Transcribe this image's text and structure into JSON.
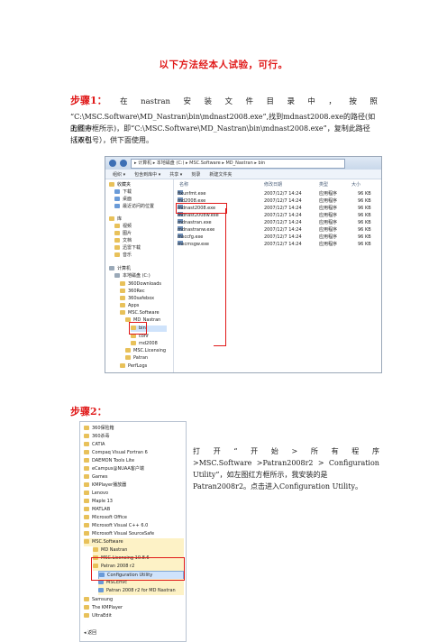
{
  "title": "以下方法经本人试验，可行。",
  "step1": {
    "label": "步骤1：",
    "line1_words": [
      "在",
      "nastran",
      "安",
      "装",
      "文",
      "件",
      "目",
      "录",
      "中",
      "，",
      "按",
      "照"
    ],
    "line2": "“C:\\MSC.Software\\MD_Nastran\\bin\\mdnast2008.exe”,找到mdnast2008.exe的路径(如上图中",
    "line3": "的红方框所示)，即“C:\\MSC.Software\\MD_Nastran\\bin\\mdnast2008.exe”，复制此路径（不包",
    "line4": "括双引号），供下面使用。"
  },
  "explorer": {
    "path": "▸ 计算机 ▸ 本地磁盘 (C:) ▸ MSC.Software ▸ MD_Nastran ▸ bin",
    "toolbar": [
      "组织 ▾",
      "包含到库中 ▾",
      "共享 ▾",
      "刻录",
      "新建文件夹"
    ],
    "nav_items": [
      "收藏夹",
      "下载",
      "桌面",
      "最近访问的位置",
      "库",
      "视频",
      "图片",
      "文档",
      "迅雷下载",
      "音乐",
      "计算机",
      "本地磁盘 (C:)",
      "360Downloads",
      "360Rec",
      "360safebox",
      "Apps",
      "MSC.Software",
      "MD_Nastran",
      "bin",
      "conf",
      "md2008",
      "MSC.Licensing",
      "Patran",
      "PerfLogs"
    ],
    "columns": [
      "名称",
      "修改日期",
      "类型",
      "大小"
    ],
    "files": [
      {
        "name": "fixunfmt.exe",
        "date": "2007/12/7 14:24",
        "type": "应用程序",
        "size": "96 KB"
      },
      {
        "name": "md2008.exe",
        "date": "2007/12/7 14:24",
        "type": "应用程序",
        "size": "96 KB"
      },
      {
        "name": "mdnast2008.exe",
        "date": "2007/12/7 14:24",
        "type": "应用程序",
        "size": "96 KB"
      },
      {
        "name": "mdnast2008w.exe",
        "date": "2007/12/7 14:24",
        "type": "应用程序",
        "size": "96 KB"
      },
      {
        "name": "mdnastran.exe",
        "date": "2007/12/7 14:24",
        "type": "应用程序",
        "size": "96 KB"
      },
      {
        "name": "mdnastranw.exe",
        "date": "2007/12/7 14:24",
        "type": "应用程序",
        "size": "96 KB"
      },
      {
        "name": "msccfg.exe",
        "date": "2007/12/7 14:24",
        "type": "应用程序",
        "size": "96 KB"
      },
      {
        "name": "mscmsgw.exe",
        "date": "2007/12/7 14:24",
        "type": "应用程序",
        "size": "96 KB"
      }
    ]
  },
  "step2": {
    "label": "步骤2：",
    "line1_words": [
      "打",
      "开",
      "“",
      "开",
      "始",
      ">",
      "所",
      "有",
      "程",
      "序"
    ],
    "line2_left": ">MSC.Software",
    "line2_mid": ">Patran2008r2",
    "line2_sep": ">",
    "line2_right": "Configuration",
    "line3": "Utility”，如左图红方框所示，我安装的是",
    "line4": "Patran2008r2。点击进入Configuration Utility。"
  },
  "start_menu": {
    "items": [
      "360保险箱",
      "360杀毒",
      "CATIA",
      "Compaq Visual Fortran 6",
      "DAEMON Tools Lite",
      "eCampus@NUAA客户端",
      "Games",
      "KMPlayer播放器",
      "Lenovo",
      "Maple 13",
      "MATLAB",
      "Microsoft Office",
      "Microsoft Visual C++ 6.0",
      "Microsoft Visual SourceSafe",
      "MSC.Software",
      "MD Nastran",
      "MSC.Licensing 10.8.6",
      "Patran 2008 r2",
      "Configuration Utility",
      "MSCEnvc",
      "Patran 2008 r2 for MD Nastran",
      "Samsung",
      "The KMPlayer",
      "UltraEdit"
    ],
    "back": "◂   返回"
  },
  "colors": {
    "accent_red": "#e01818"
  }
}
